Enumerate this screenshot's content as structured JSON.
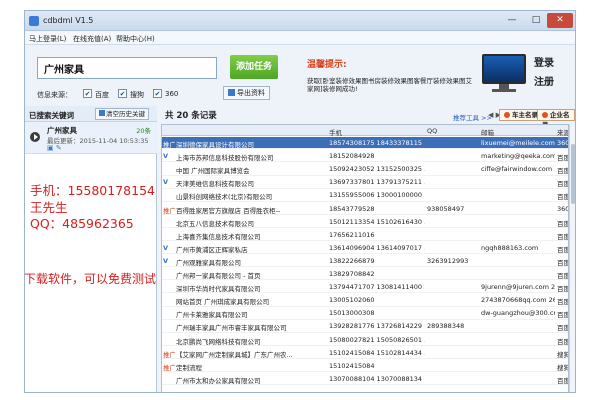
{
  "window": {
    "title": "cdbdml V1.5",
    "minimize": "—",
    "maximize": "□",
    "close": "✕"
  },
  "menu": {
    "items": [
      "马上登录(L)",
      "在线充值(A)",
      "帮助中心(H)"
    ]
  },
  "search": {
    "value": "广州家具",
    "add_task_label": "添加任务",
    "engine_label": "信息来源：",
    "engines": [
      {
        "label": "百度",
        "checked": true
      },
      {
        "label": "搜狗",
        "checked": true
      },
      {
        "label": "360",
        "checked": true
      }
    ],
    "export_label": "导出资料"
  },
  "tip": {
    "title": "温馨提示:",
    "body": "获取[卧室装修效果图书房装修效果图客餐厅装修效果图艾家网]装修网成功!"
  },
  "account": {
    "login": "登录",
    "register": "注册"
  },
  "left_panel": {
    "title": "已搜索关键词",
    "clear_label": "清空历史关键",
    "keyword": {
      "name": "广州家具",
      "count": "20条",
      "last_search": "最后更新：2015-11-04 10:53:35"
    }
  },
  "overlay": {
    "phone": "手机：15580178154",
    "name": "王先生",
    "qq": "QQ：485962365",
    "download": "下载软件，可以免费测试"
  },
  "records": {
    "prefix": "共",
    "count": "20",
    "suffix": "条记录",
    "tool_link": "推荐工具 >>",
    "nav": "◀ ▶",
    "btn_car": "车主名录",
    "btn_business": "企业名录",
    "columns": [
      "",
      "",
      "手机",
      "QQ",
      "邮箱",
      "来源"
    ],
    "rows": [
      {
        "tag": "推广",
        "company": "深圳德保家具设计有限公司",
        "phone": "18574308175  18433378115",
        "qq": "",
        "email": "lixuemei@meilele.com  c",
        "source": "360",
        "selected": true
      },
      {
        "tag": "V",
        "company": "上海市苏邦信息科技股份有限公司",
        "phone": "18152084928",
        "qq": "",
        "email": "marketing@qeeka.com  tg",
        "source": "百度",
        "selected": false
      },
      {
        "tag": "",
        "company": "中国 广州国际家具博览会",
        "phone": "15092423052  13152500325  .",
        "qq": "",
        "email": "ciffe@fairwindow.com",
        "source": "百度",
        "selected": false
      },
      {
        "tag": "V",
        "company": "天津美维信息科技有限公司",
        "phone": "13697337801  13791375211  .",
        "qq": "",
        "email": "",
        "source": "百度",
        "selected": false
      },
      {
        "tag": "",
        "company": "山景科创网络技术(北京)有限公司",
        "phone": "13155955006  13000100000",
        "qq": "",
        "email": "",
        "source": "百度",
        "selected": false
      },
      {
        "tag": "推广",
        "company": "百得胜家居官方旗舰店 百得胜衣柜--",
        "phone": "18543779528",
        "qq": "938058497",
        "email": "",
        "source": "360",
        "selected": false
      },
      {
        "tag": "",
        "company": "北京五八信息技术有限公司",
        "phone": "15012113354  15102616430  .",
        "qq": "",
        "email": "",
        "source": "百度",
        "selected": false
      },
      {
        "tag": "",
        "company": "上海喜齐集信息技术有限公司",
        "phone": "17656211016",
        "qq": "",
        "email": "",
        "source": "百度",
        "selected": false
      },
      {
        "tag": "V",
        "company": "广州市黄浦区正辉家私店",
        "phone": "13614096904  13614097017  .",
        "qq": "",
        "email": "ngqh888163.com",
        "source": "百度",
        "selected": false
      },
      {
        "tag": "V",
        "company": "广州观雅家具有限公司",
        "phone": "13822266879",
        "qq": "3263912993",
        "email": "",
        "source": "百度",
        "selected": false
      },
      {
        "tag": "",
        "company": "广州邦一家具有限公司 - 首页",
        "phone": "13829708842",
        "qq": "",
        "email": "",
        "source": "百度",
        "selected": false
      },
      {
        "tag": "",
        "company": "深圳市华尚时代家具有限公司",
        "phone": "13794471707  13081411400",
        "qq": "",
        "email": "9jurenn@9juren.com  2636",
        "source": "百度",
        "selected": false
      },
      {
        "tag": "",
        "company": "网站首页 广州琪成家具有限公司",
        "phone": "13005102060",
        "qq": "",
        "email": "2743870668qq.com  26352",
        "source": "百度",
        "selected": false
      },
      {
        "tag": "",
        "company": "广州卡莱雅家具有限公司",
        "phone": "15013000308",
        "qq": "",
        "email": "dw-guangzhou@300.cn",
        "source": "百度",
        "selected": false
      },
      {
        "tag": "",
        "company": "广州瑞丰家具广州市睿丰家具有限公司",
        "phone": "13928281776  13726814229",
        "qq": "289388348",
        "email": "",
        "source": "百度",
        "selected": false
      },
      {
        "tag": "",
        "company": "北京鹏尚飞网络科技有限公司",
        "phone": "15080027821  15050826501  .",
        "qq": "",
        "email": "",
        "source": "百度",
        "selected": false
      },
      {
        "tag": "推广",
        "company": "【艾家网广州定制家具城】广东广州农...",
        "phone": "15102415084  15102814434  .",
        "qq": "",
        "email": "",
        "source": "搜狗",
        "selected": false
      },
      {
        "tag": "推广",
        "company": "定制流程",
        "phone": "15102415084",
        "qq": "",
        "email": "",
        "source": "搜狗",
        "selected": false
      },
      {
        "tag": "",
        "company": "广州市太和办公家具有限公司",
        "phone": "13070088104  13070088134",
        "qq": "",
        "email": "",
        "source": "百度",
        "selected": false
      }
    ]
  },
  "colors": {
    "accent": "#3d6fb8",
    "add_task": "#5cb030",
    "tip_title": "#d8431b",
    "overlay_text": "#d81e1e"
  }
}
